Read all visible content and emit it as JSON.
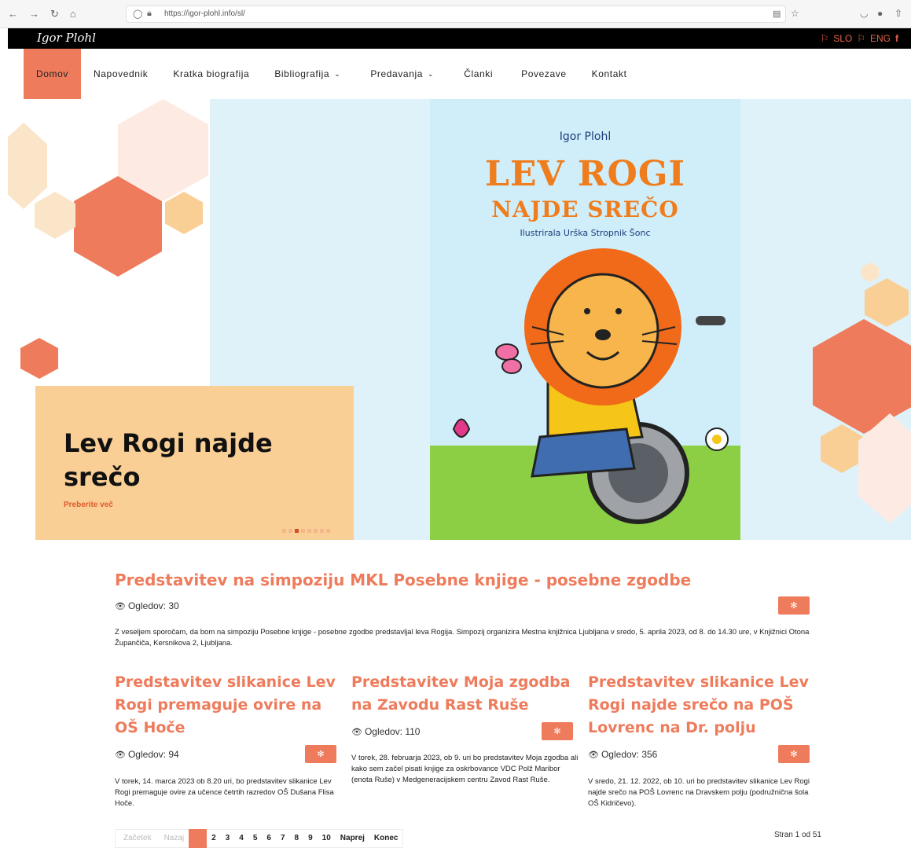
{
  "browser": {
    "url": "https://igor-plohl.info/sl/"
  },
  "site": {
    "logo": "Igor Plohl",
    "lang_slo": "SLO",
    "lang_eng": "ENG",
    "facebook": "f"
  },
  "nav": {
    "home": "Domov",
    "napovednik": "Napovednik",
    "bio": "Kratka biografija",
    "biblio": "Bibliografija",
    "predavanja": "Predavanja",
    "clanki": "Članki",
    "povezave": "Povezave",
    "kontakt": "Kontakt"
  },
  "hero": {
    "cover_author": "Igor Plohl",
    "cover_title_1": "LEV ROGI",
    "cover_title_2": "NAJDE SREČO",
    "cover_illustrator": "Ilustrirala Urška Stropnik Šonc",
    "caption_title": "Lev Rogi najde srečo",
    "caption_link": "Preberite več",
    "active_slide": 3,
    "slide_count": 8
  },
  "featured": {
    "title": "Predstavitev na simpoziju MKL Posebne knjige - posebne zgodbe",
    "views": "Ogledov: 30",
    "text": "Z veseljem sporočam, da bom na simpoziju Posebne knjige - posebne zgodbe predstavljal leva Rogija. Simpozij organizira Mestna knjižnica Ljubljana v sredo, 5. aprila 2023, od 8. do 14.30 ure, v Knjižnici Otona Župančiča, Kersnikova 2, Ljubljana."
  },
  "articles": [
    {
      "title": "Predstavitev slikanice Lev Rogi premaguje ovire na OŠ Hoče",
      "views": "Ogledov: 94",
      "text": "V torek, 14. marca 2023 ob 8.20 uri, bo predstavitev slikanice Lev Rogi premaguje ovire za učence četrtih razredov OŠ Dušana Flisa Hoče."
    },
    {
      "title": "Predstavitev Moja zgodba na Zavodu Rast Ruše",
      "views": "Ogledov: 110",
      "text": "V torek, 28. februarja 2023, ob 9. uri bo predstavitev Moja zgodba ali kako sem začel pisati knjige za oskrbovance VDC Polž Maribor (enota Ruše) v Medgeneracijskem centru Zavod Rast Ruše."
    },
    {
      "title": "Predstavitev slikanice Lev Rogi najde srečo na POŠ Lovrenc na Dr. polju",
      "views": "Ogledov: 356",
      "text": "V sredo, 21. 12. 2022, ob 10. uri bo predstavitev slikanice Lev Rogi najde srečo na POŠ Lovrenc na Dravskem polju (podružnična šola OŠ Kidričevo)."
    }
  ],
  "pagination": {
    "first": "Začetek",
    "prev": "Nazaj",
    "current": "1",
    "pages": [
      "2",
      "3",
      "4",
      "5",
      "6",
      "7",
      "8",
      "9",
      "10"
    ],
    "next": "Naprej",
    "last": "Konec",
    "info": "Stran 1 od 51"
  }
}
